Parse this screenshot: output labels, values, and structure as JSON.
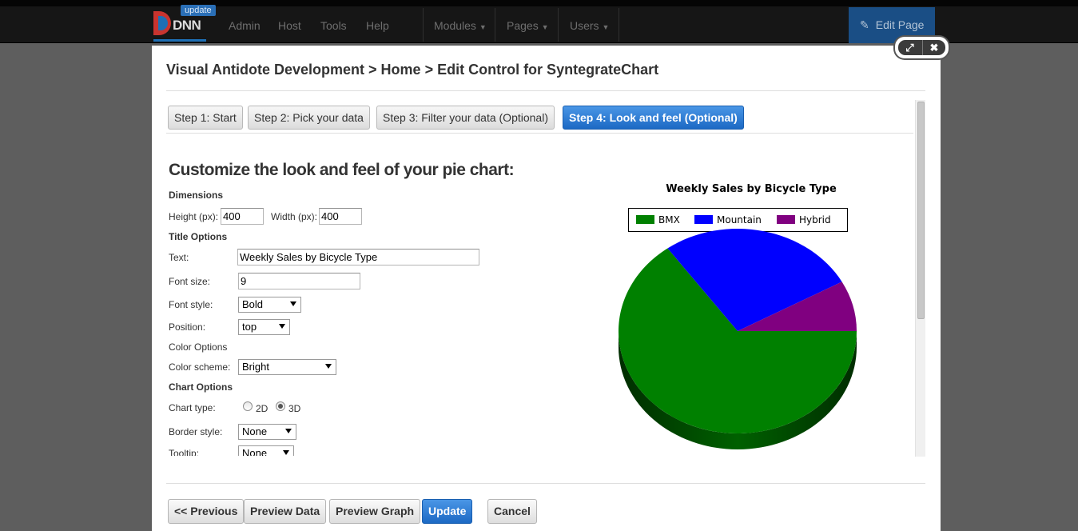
{
  "topbar": {
    "logo_text": "DNN",
    "update_badge": "update",
    "nav_left": [
      "Admin",
      "Host",
      "Tools",
      "Help"
    ],
    "nav_right": [
      "Modules",
      "Pages",
      "Users"
    ],
    "edit_page_label": "Edit Page"
  },
  "modal": {
    "title": "Visual Antidote Development > Home > Edit Control for SyntegrateChart",
    "steps": [
      {
        "label": "Step 1: Start",
        "active": false
      },
      {
        "label": "Step 2: Pick your data",
        "active": false
      },
      {
        "label": "Step 3: Filter your data (Optional)",
        "active": false
      },
      {
        "label": "Step 4: Look and feel (Optional)",
        "active": true
      }
    ],
    "heading": "Customize the look and feel of your pie chart:",
    "dimensions": {
      "label": "Dimensions",
      "height_label": "Height (px):",
      "height_value": "400",
      "width_label": "Width (px):",
      "width_value": "400"
    },
    "title_options": {
      "label": "Title Options",
      "text_label": "Text:",
      "text_value": "Weekly Sales by Bicycle Type",
      "font_size_label": "Font size:",
      "font_size_value": "9",
      "font_style_label": "Font style:",
      "font_style_value": "Bold",
      "position_label": "Position:",
      "position_value": "top"
    },
    "color_options": {
      "label": "Color Options",
      "scheme_label": "Color scheme:",
      "scheme_value": "Bright"
    },
    "chart_options": {
      "label": "Chart Options",
      "type_label": "Chart type:",
      "type_2d": "2D",
      "type_3d": "3D",
      "type_selected": "3D",
      "border_label": "Border style:",
      "border_value": "None",
      "tooltip_label": "Tooltip:",
      "tooltip_value": "None"
    },
    "footer": {
      "previous": "<< Previous",
      "preview_data": "Preview Data",
      "preview_graph": "Preview Graph",
      "update": "Update",
      "cancel": "Cancel"
    }
  },
  "chart_data": {
    "type": "pie",
    "title": "Weekly Sales by Bicycle Type",
    "legend_position": "top",
    "categories": [
      "BMX",
      "Mountain",
      "Hybrid"
    ],
    "values": [
      65,
      27,
      8
    ],
    "colors": [
      "#008000",
      "#0000ff",
      "#800080"
    ],
    "style": "3D"
  }
}
